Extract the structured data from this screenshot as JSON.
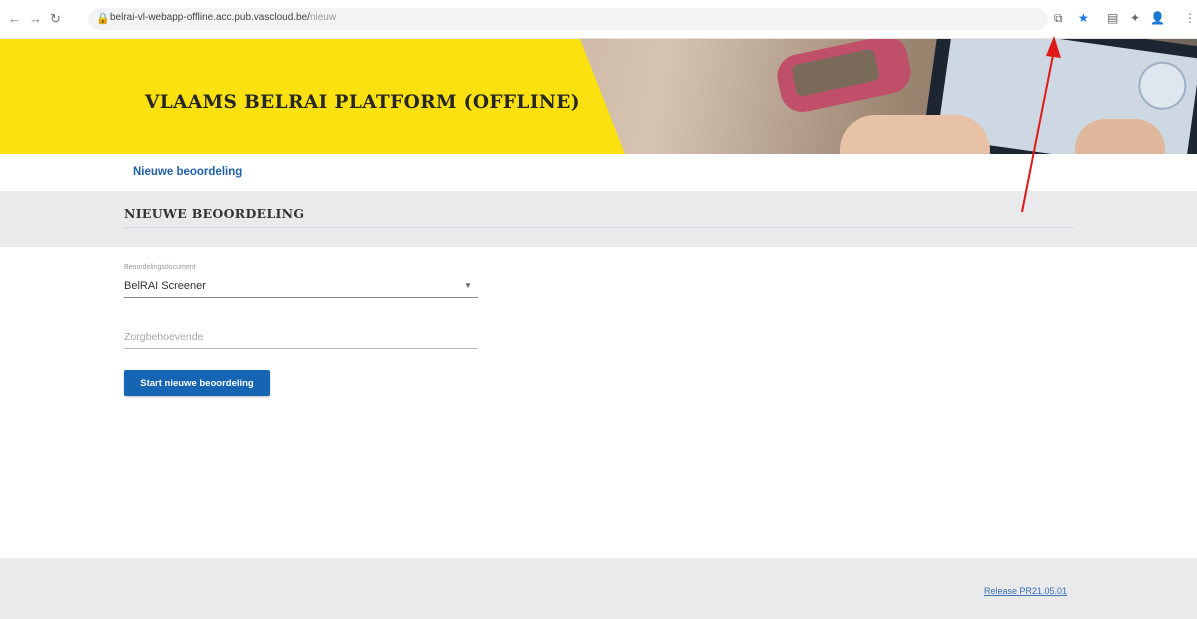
{
  "browser": {
    "url_host": "belrai-vl-webapp-offline.acc.pub.vascloud.be/",
    "url_path": "nieuw"
  },
  "header": {
    "title": "VLAAMS BELRAI PLATFORM (OFFLINE)"
  },
  "nav": {
    "tabs": [
      {
        "label": "Nieuwe beoordeling"
      }
    ]
  },
  "page": {
    "title": "NIEUWE BEOORDELING"
  },
  "form": {
    "document_label": "Beoordelingsdocument",
    "document_value": "BelRAI Screener",
    "person_placeholder": "Zorgbehoevende",
    "start_label": "Start nieuwe beoordeling"
  },
  "footer": {
    "release": "Release PR21.05.01"
  },
  "icons": {
    "back": "arrow-left-icon",
    "forward": "arrow-right-icon",
    "reload": "reload-icon",
    "lock": "lock-icon",
    "install": "install-app-icon",
    "bookmark": "star-icon",
    "extensions": "puzzle-icon",
    "profile": "person-icon",
    "menu": "kebab-menu-icon"
  },
  "colors": {
    "banner_yellow": "#fbe10f",
    "link_blue": "#1f5ea8",
    "button_blue": "#1565b3",
    "strip_gray": "#e8eaec",
    "annotation_red": "#e01919"
  }
}
